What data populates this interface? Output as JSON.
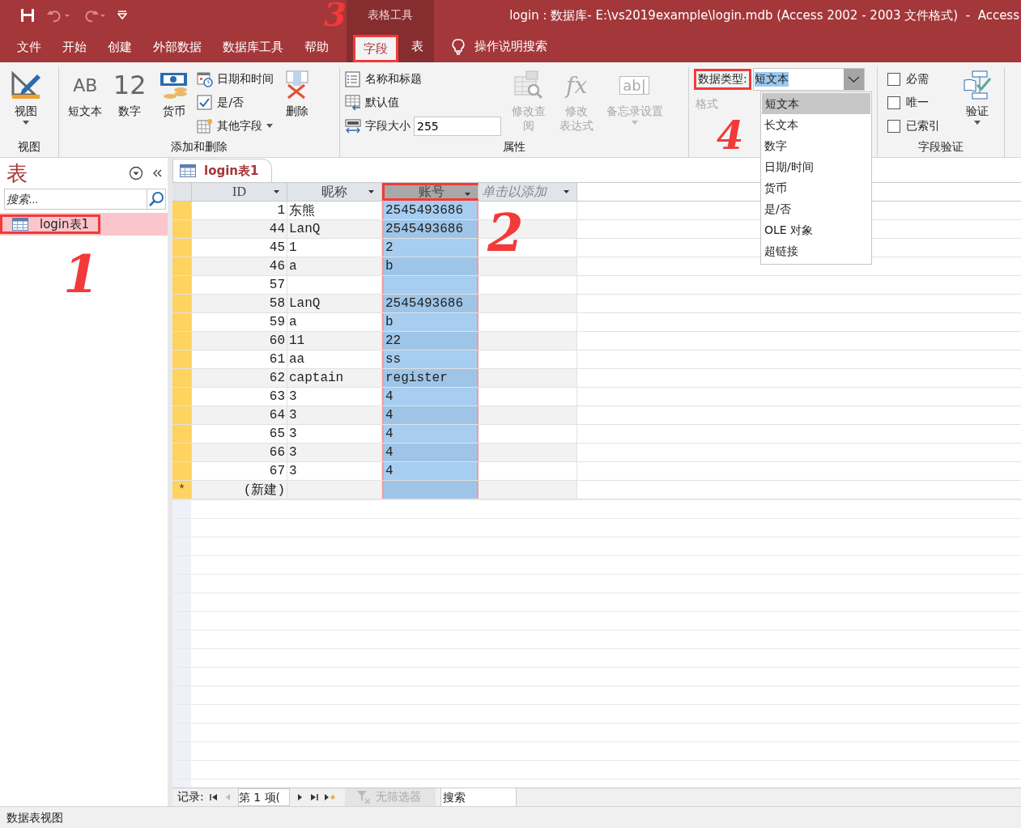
{
  "window": {
    "title": "login : 数据库- E:\\vs2019example\\login.mdb (Access 2002 - 2003 文件格式)  -  Access",
    "context_group": "表格工具"
  },
  "ribbon_tabs": [
    {
      "label": "文件",
      "selected": false
    },
    {
      "label": "开始",
      "selected": false
    },
    {
      "label": "创建",
      "selected": false
    },
    {
      "label": "外部数据",
      "selected": false
    },
    {
      "label": "数据库工具",
      "selected": false
    },
    {
      "label": "帮助",
      "selected": false
    },
    {
      "label": "字段",
      "selected": true,
      "contextual": true,
      "marker": "3"
    },
    {
      "label": "表",
      "selected": false,
      "contextual": true
    }
  ],
  "tell_me": "操作说明搜索",
  "ribbon_groups": [
    {
      "label": "视图",
      "controls": [
        {
          "kind": "large",
          "label": "视图",
          "dropdown": true
        }
      ]
    },
    {
      "label": "添加和删除",
      "controls": [
        {
          "kind": "large",
          "label": "短文本",
          "icon_text": "AB"
        },
        {
          "kind": "large",
          "label": "数字",
          "icon_text": "12"
        },
        {
          "kind": "large",
          "label": "货币"
        },
        {
          "kind": "stack",
          "items": [
            {
              "kind": "small",
              "label": "日期和时间"
            },
            {
              "kind": "small",
              "label": "是/否"
            },
            {
              "kind": "small",
              "label": "其他字段",
              "dropdown": true
            }
          ]
        },
        {
          "kind": "large",
          "label": "删除"
        }
      ]
    },
    {
      "label": "属性",
      "controls": [
        {
          "kind": "stack",
          "items": [
            {
              "kind": "small",
              "label": "名称和标题"
            },
            {
              "kind": "small",
              "label": "默认值"
            },
            {
              "kind": "field",
              "label": "字段大小",
              "value": "255"
            }
          ]
        },
        {
          "kind": "large",
          "label": "修改查阅",
          "disabled": true
        },
        {
          "kind": "large",
          "label_lines": [
            "修改",
            "表达式"
          ],
          "disabled": true,
          "icon_text": "fx"
        },
        {
          "kind": "large",
          "label": "备忘录设置",
          "disabled": true,
          "dropdown": true,
          "icon_text": "ab|"
        }
      ]
    },
    {
      "controls": [
        {
          "kind": "stack",
          "items": [
            {
              "kind": "combo",
              "label": "数据类型:",
              "value": "短文本",
              "open": true,
              "marker": "4",
              "options": [
                {
                  "label": "短文本",
                  "selected": true
                },
                {
                  "label": "长文本",
                  "selected": false
                },
                {
                  "label": "数字",
                  "selected": false
                },
                {
                  "label": "日期/时间",
                  "selected": false
                },
                {
                  "label": "货币",
                  "selected": false
                },
                {
                  "label": "是/否",
                  "selected": false
                },
                {
                  "label": "OLE 对象",
                  "selected": false
                },
                {
                  "label": "超链接",
                  "selected": false
                }
              ]
            },
            {
              "kind": "text",
              "label": "格式",
              "disabled": true
            }
          ]
        }
      ]
    },
    {
      "label": "字段验证",
      "controls": [
        {
          "kind": "stack",
          "items": [
            {
              "kind": "checkbox",
              "label": "必需",
              "checked": false
            },
            {
              "kind": "checkbox",
              "label": "唯一",
              "checked": false
            },
            {
              "kind": "checkbox",
              "label": "已索引",
              "checked": false
            }
          ]
        },
        {
          "kind": "large",
          "label": "验证",
          "dropdown": true
        }
      ]
    }
  ],
  "nav_pane": {
    "title": "表",
    "search": {
      "placeholder": "搜索..."
    },
    "items": [
      {
        "label": "login表1",
        "selected": true,
        "marker": "1"
      }
    ]
  },
  "document_tab": {
    "label": "login表1"
  },
  "table": {
    "columns": [
      {
        "label": "ID",
        "selected": false
      },
      {
        "label": "昵称",
        "selected": false
      },
      {
        "label": "账号",
        "selected": true,
        "marker": "2"
      },
      {
        "label": "单击以添加",
        "selected": false,
        "kind": "add"
      }
    ],
    "rows": [
      {
        "id": "1",
        "nickname": "东熊",
        "account": "2545493686"
      },
      {
        "id": "44",
        "nickname": "LanQ",
        "account": "2545493686"
      },
      {
        "id": "45",
        "nickname": "1",
        "account": "2"
      },
      {
        "id": "46",
        "nickname": "a",
        "account": "b"
      },
      {
        "id": "57"
      },
      {
        "id": "58",
        "nickname": "LanQ",
        "account": "2545493686"
      },
      {
        "id": "59",
        "nickname": "a",
        "account": "b"
      },
      {
        "id": "60",
        "nickname": "11",
        "account": "22"
      },
      {
        "id": "61",
        "nickname": "aa",
        "account": "ss"
      },
      {
        "id": "62",
        "nickname": "captain",
        "account": "register"
      },
      {
        "id": "63",
        "nickname": "3",
        "account": "4"
      },
      {
        "id": "64",
        "nickname": "3",
        "account": "4"
      },
      {
        "id": "65",
        "nickname": "3",
        "account": "4"
      },
      {
        "id": "66",
        "nickname": "3",
        "account": "4"
      },
      {
        "id": "67",
        "nickname": "3",
        "account": "4"
      }
    ],
    "new_row": {
      "marker": "*",
      "label": "(新建)"
    }
  },
  "record_nav": {
    "label": "记录:",
    "position": "第 1 项(",
    "filter": "无筛选器",
    "search": {
      "placeholder": "搜索"
    }
  },
  "status_bar": {
    "text": "数据表视图"
  }
}
